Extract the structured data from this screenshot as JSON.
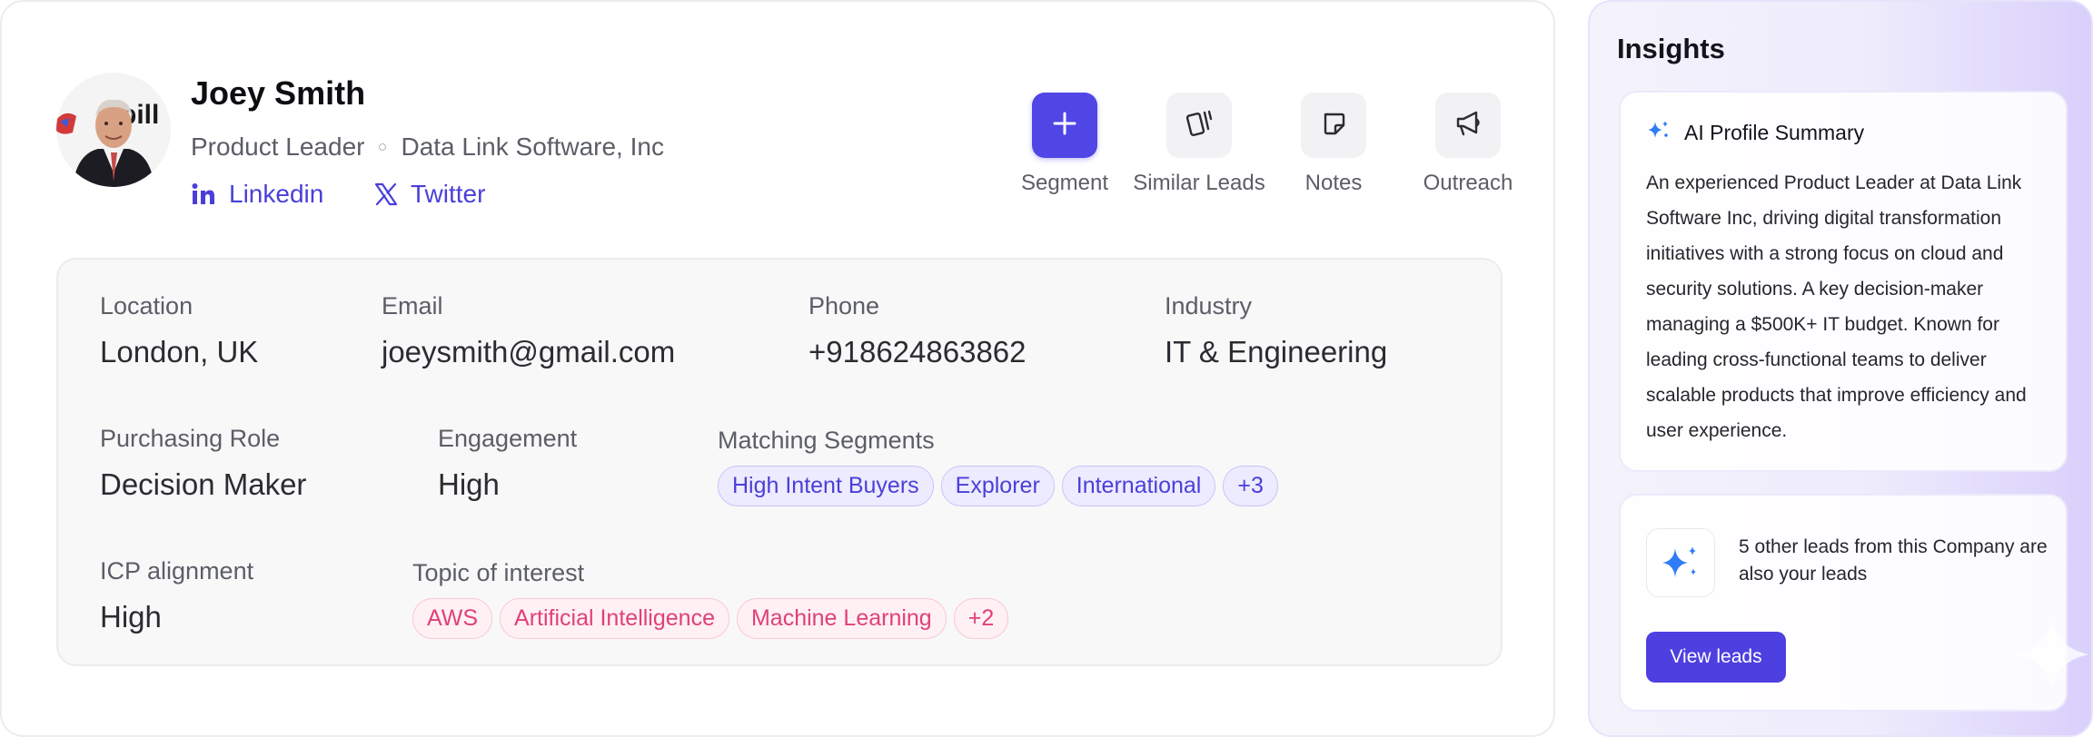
{
  "profile": {
    "name": "Joey Smith",
    "title": "Product Leader",
    "company": "Data Link Software, Inc",
    "social": {
      "linkedin": "Linkedin",
      "twitter": "Twitter"
    }
  },
  "actions": [
    {
      "label": "Segment",
      "icon": "plus-icon"
    },
    {
      "label": "Similar Leads",
      "icon": "cards-icon"
    },
    {
      "label": "Notes",
      "icon": "note-icon"
    },
    {
      "label": "Outreach",
      "icon": "megaphone-icon"
    }
  ],
  "details": {
    "location": {
      "label": "Location",
      "value": "London, UK"
    },
    "email": {
      "label": "Email",
      "value": "joeysmith@gmail.com"
    },
    "phone": {
      "label": "Phone",
      "value": "+918624863862"
    },
    "industry": {
      "label": "Industry",
      "value": "IT & Engineering"
    },
    "purchasing_role": {
      "label": "Purchasing Role",
      "value": "Decision Maker"
    },
    "engagement": {
      "label": "Engagement",
      "value": "High"
    },
    "matching_segments": {
      "label": "Matching Segments",
      "chips": [
        "High Intent Buyers",
        "Explorer",
        "International",
        "+3"
      ]
    },
    "icp_alignment": {
      "label": "ICP alignment",
      "value": "High"
    },
    "topic_of_interest": {
      "label": "Topic of interest",
      "chips": [
        "AWS",
        "Artificial Intelligence",
        "Machine Learning",
        "+2"
      ]
    }
  },
  "insights": {
    "title": "Insights",
    "summary_title": "AI Profile Summary",
    "summary_text": "An experienced Product Leader at Data Link Software Inc, driving digital transformation initiatives with a strong focus on cloud and security solutions. A key decision-maker managing a $500K+ IT budget. Known for leading cross-functional teams to deliver scalable products that improve efficiency and user experience.",
    "leads_text": "5 other leads from this Company are also your leads",
    "view_leads_label": "View leads"
  },
  "colors": {
    "accent": "#5046e5",
    "segment_chip": "#4a3fd8",
    "topic_chip": "#e0407a",
    "spark": "#2f7cf6"
  }
}
